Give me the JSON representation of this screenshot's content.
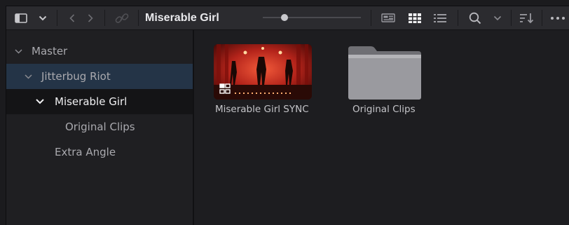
{
  "toolbar": {
    "title": "Miserable Girl",
    "icons": [
      "sidebar-toggle-icon",
      "chevron-down-icon",
      "back-arrow-icon",
      "forward-arrow-icon",
      "link-icon",
      "metadata-view-icon",
      "thumbnail-view-icon",
      "list-view-icon",
      "search-icon",
      "chevron-down-icon",
      "sort-icon",
      "more-icon"
    ]
  },
  "sidebar": {
    "items": [
      {
        "label": "Master"
      },
      {
        "label": "Jitterbug Riot"
      },
      {
        "label": "Miserable Girl"
      },
      {
        "label": "Original Clips"
      },
      {
        "label": "Extra Angle"
      }
    ]
  },
  "content": {
    "items": [
      {
        "label": "Miserable Girl SYNC",
        "type": "timeline"
      },
      {
        "label": "Original Clips",
        "type": "folder"
      }
    ]
  },
  "colors": {
    "highlight": "#243447",
    "selected": "#141416",
    "toolbar": "#2b2b2f"
  }
}
